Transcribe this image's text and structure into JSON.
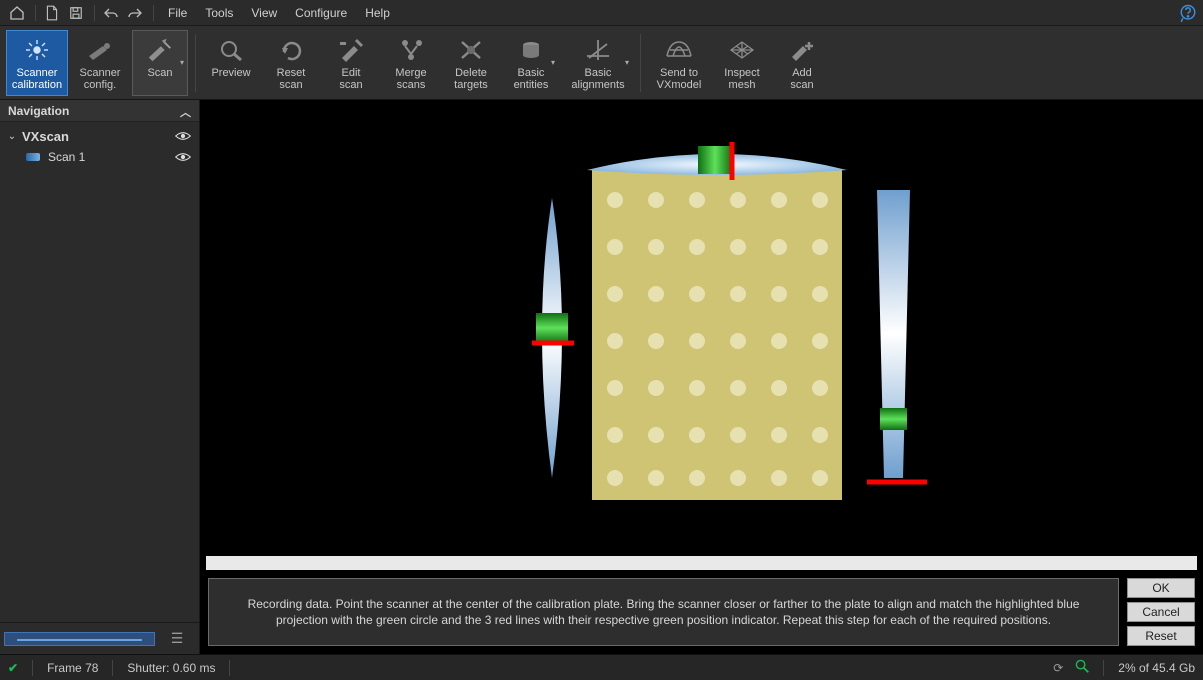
{
  "menu": {
    "file": "File",
    "tools": "Tools",
    "view": "View",
    "configure": "Configure",
    "help": "Help"
  },
  "ribbon": {
    "scanner_calibration": "Scanner\ncalibration",
    "scanner_config": "Scanner\nconfig.",
    "scan": "Scan",
    "preview": "Preview",
    "reset_scan": "Reset\nscan",
    "edit_scan": "Edit\nscan",
    "merge_scans": "Merge\nscans",
    "delete_targets": "Delete\ntargets",
    "basic_entities": "Basic\nentities",
    "basic_alignments": "Basic\nalignments",
    "send_to_vxmodel": "Send to\nVXmodel",
    "inspect_mesh": "Inspect\nmesh",
    "add_scan": "Add\nscan"
  },
  "nav": {
    "title": "Navigation",
    "root_label": "VXscan",
    "item1_label": "Scan 1"
  },
  "instruction": {
    "text": "Recording data. Point the scanner at the center of the calibration plate. Bring the scanner closer or farther to the plate to align and match the highlighted blue projection with the green circle and the 3 red lines with their respective green position indicator. Repeat this step for each of the required positions."
  },
  "buttons": {
    "ok": "OK",
    "cancel": "Cancel",
    "reset": "Reset"
  },
  "status": {
    "frame": "Frame 78",
    "shutter": "Shutter: 0.60 ms",
    "memory": "2% of 45.4 Gb"
  },
  "colors": {
    "accent": "#1d5aa1",
    "green": "#1db954",
    "red": "#ff0000"
  }
}
